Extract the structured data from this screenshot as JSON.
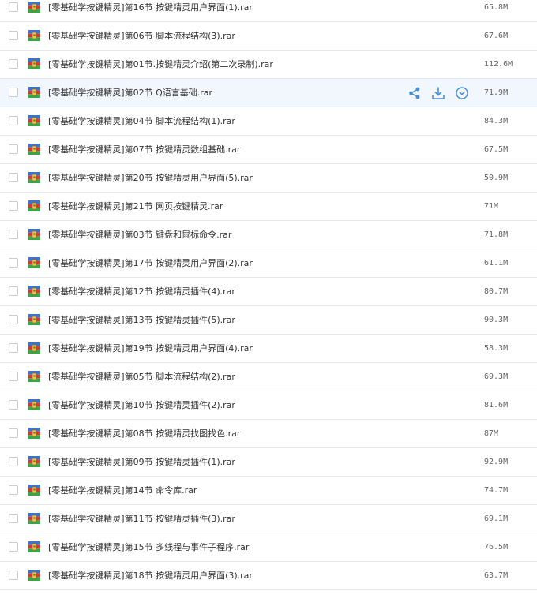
{
  "files": [
    {
      "name": "[零基础学按键精灵]第16节 按键精灵用户界面(1).rar",
      "size": "65.8M"
    },
    {
      "name": "[零基础学按键精灵]第06节 脚本流程结构(3).rar",
      "size": "67.6M"
    },
    {
      "name": "[零基础学按键精灵]第01节.按键精灵介绍(第二次录制).rar",
      "size": "112.6M"
    },
    {
      "name": "[零基础学按键精灵]第02节 Q语言基础.rar",
      "size": "71.9M",
      "hover": true
    },
    {
      "name": "[零基础学按键精灵]第04节 脚本流程结构(1).rar",
      "size": "84.3M"
    },
    {
      "name": "[零基础学按键精灵]第07节 按键精灵数组基础.rar",
      "size": "67.5M"
    },
    {
      "name": "[零基础学按键精灵]第20节 按键精灵用户界面(5).rar",
      "size": "50.9M"
    },
    {
      "name": "[零基础学按键精灵]第21节 网页按键精灵.rar",
      "size": "71M"
    },
    {
      "name": "[零基础学按键精灵]第03节 键盘和鼠标命令.rar",
      "size": "71.8M"
    },
    {
      "name": "[零基础学按键精灵]第17节 按键精灵用户界面(2).rar",
      "size": "61.1M"
    },
    {
      "name": "[零基础学按键精灵]第12节 按键精灵插件(4).rar",
      "size": "80.7M"
    },
    {
      "name": "[零基础学按键精灵]第13节 按键精灵插件(5).rar",
      "size": "90.3M"
    },
    {
      "name": "[零基础学按键精灵]第19节 按键精灵用户界面(4).rar",
      "size": "58.3M"
    },
    {
      "name": "[零基础学按键精灵]第05节 脚本流程结构(2).rar",
      "size": "69.3M"
    },
    {
      "name": "[零基础学按键精灵]第10节 按键精灵插件(2).rar",
      "size": "81.6M"
    },
    {
      "name": "[零基础学按键精灵]第08节 按键精灵找图找色.rar",
      "size": "87M"
    },
    {
      "name": "[零基础学按键精灵]第09节 按键精灵插件(1).rar",
      "size": "92.9M"
    },
    {
      "name": "[零基础学按键精灵]第14节 命令库.rar",
      "size": "74.7M"
    },
    {
      "name": "[零基础学按键精灵]第11节 按键精灵插件(3).rar",
      "size": "69.1M"
    },
    {
      "name": "[零基础学按键精灵]第15节 多线程与事件子程序.rar",
      "size": "76.5M"
    },
    {
      "name": "[零基础学按键精灵]第18节 按键精灵用户界面(3).rar",
      "size": "63.7M"
    }
  ],
  "icons": {
    "file": "archive-file-icon",
    "share": "share-icon",
    "download": "download-icon",
    "more": "more-dropdown-icon"
  },
  "colors": {
    "accent": "#4a90d9",
    "hover_row": "#f2f7fd",
    "divider": "#e6eaf0"
  }
}
